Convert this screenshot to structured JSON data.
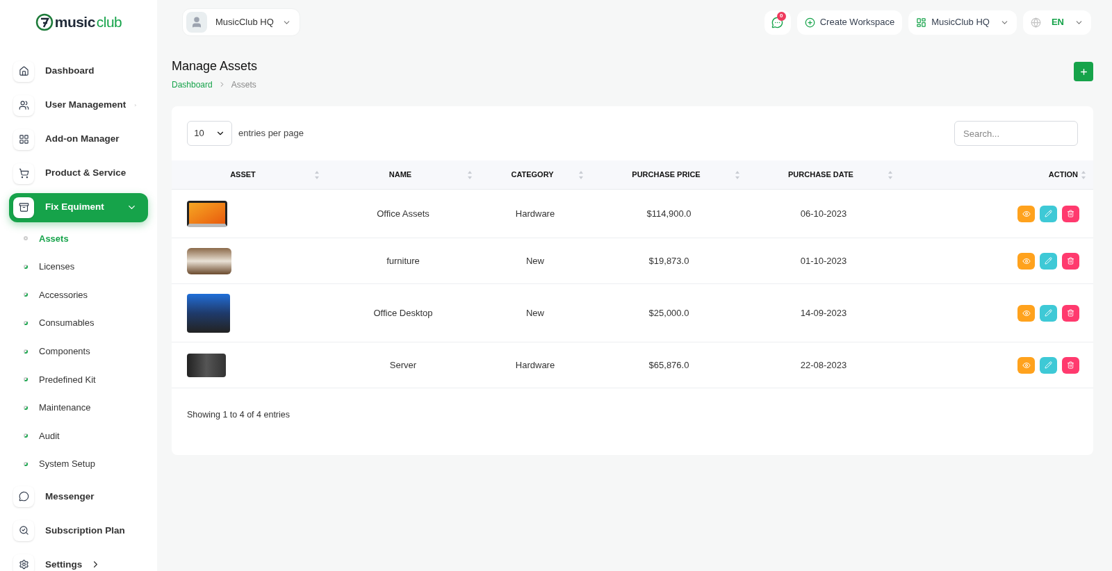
{
  "logo": {
    "first": "music",
    "second": "club"
  },
  "workspace_switcher": {
    "label": "MusicClub HQ"
  },
  "header": {
    "notification_count": "0",
    "create_button": "Create Workspace",
    "workspace": "MusicClub HQ",
    "language": "EN"
  },
  "sidebar": {
    "items": [
      {
        "label": "Dashboard",
        "selected": false
      },
      {
        "label": "User Management",
        "selected": false,
        "expanded": false
      },
      {
        "label": "Add-on Manager",
        "selected": false
      },
      {
        "label": "Product & Service",
        "selected": false
      },
      {
        "label": "Fix Equiment",
        "selected": true,
        "expanded": true,
        "children": [
          {
            "label": "Assets",
            "selected": true
          },
          {
            "label": "Licenses",
            "selected": false
          },
          {
            "label": "Accessories",
            "selected": false
          },
          {
            "label": "Consumables",
            "selected": false
          },
          {
            "label": "Components",
            "selected": false
          },
          {
            "label": "Predefined Kit",
            "selected": false
          },
          {
            "label": "Maintenance",
            "selected": false
          },
          {
            "label": "Audit",
            "selected": false
          },
          {
            "label": "System Setup",
            "selected": false
          }
        ]
      },
      {
        "label": "Messenger",
        "selected": false
      },
      {
        "label": "Subscription Plan",
        "selected": false
      },
      {
        "label": "Settings",
        "selected": false,
        "expanded": false
      }
    ]
  },
  "page": {
    "title": "Manage Assets",
    "breadcrumb": [
      {
        "label": "Dashboard",
        "selected": false
      },
      {
        "label": "Assets",
        "selected": true
      }
    ]
  },
  "table": {
    "page_size": "10",
    "page_size_label": "entries per page",
    "search_placeholder": "Search...",
    "columns": [
      "ASSET",
      "NAME",
      "CATEGORY",
      "PURCHASE PRICE",
      "PURCHASE DATE",
      "ACTION"
    ],
    "rows": [
      {
        "name": "Office Assets",
        "category": "Hardware",
        "price": "$114,900.0",
        "date": "06-10-2023"
      },
      {
        "name": "furniture",
        "category": "New",
        "price": "$19,873.0",
        "date": "01-10-2023"
      },
      {
        "name": "Office Desktop",
        "category": "New",
        "price": "$25,000.0",
        "date": "14-09-2023"
      },
      {
        "name": "Server",
        "category": "Hardware",
        "price": "$65,876.0",
        "date": "22-08-2023"
      }
    ],
    "footer": "Showing 1 to 4 of 4 entries"
  }
}
